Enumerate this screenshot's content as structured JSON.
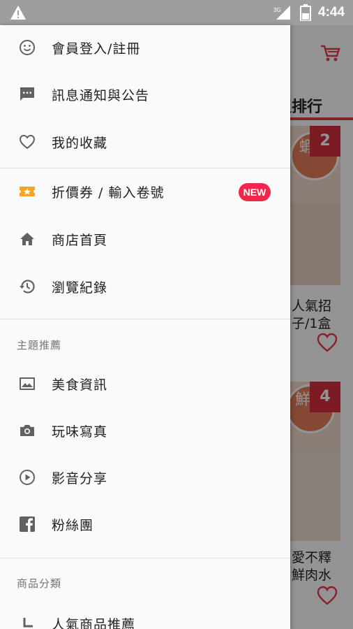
{
  "status_bar": {
    "time": "4:44",
    "network_label": "3G",
    "icons": [
      "warning-icon",
      "signal-icon",
      "battery-icon"
    ]
  },
  "background": {
    "section_title": "週排行",
    "products": [
      {
        "rank": "2",
        "stamp": "蝦仁",
        "name_lines": [
          "人氣招",
          "子/1盒"
        ]
      },
      {
        "rank": "4",
        "stamp": "鮮肉",
        "name_lines": [
          "愛不釋",
          "鮮肉水"
        ]
      }
    ]
  },
  "drawer": {
    "items_top": [
      {
        "label": "會員登入/註冊",
        "icon": "smiley-icon"
      },
      {
        "label": "訊息通知與公告",
        "icon": "message-icon"
      },
      {
        "label": "我的收藏",
        "icon": "heart-icon"
      }
    ],
    "items_mid": [
      {
        "label": "折價券 / 輸入卷號",
        "icon": "coupon-icon",
        "badge": "NEW"
      },
      {
        "label": "商店首頁",
        "icon": "home-icon"
      },
      {
        "label": "瀏覽紀錄",
        "icon": "history-icon"
      }
    ],
    "theme_header": "主題推薦",
    "items_theme": [
      {
        "label": "美食資訊",
        "icon": "image-icon"
      },
      {
        "label": "玩味寫真",
        "icon": "camera-icon"
      },
      {
        "label": "影音分享",
        "icon": "play-icon"
      },
      {
        "label": "粉絲團",
        "icon": "facebook-icon"
      }
    ],
    "category_header": "商品分類",
    "items_category": [
      {
        "label": "人氣商品推薦",
        "icon": "subitem-corner-icon"
      }
    ]
  },
  "colors": {
    "accent": "#e8394b",
    "new_badge": "#f0264a",
    "coupon_icon": "#f5a623"
  }
}
